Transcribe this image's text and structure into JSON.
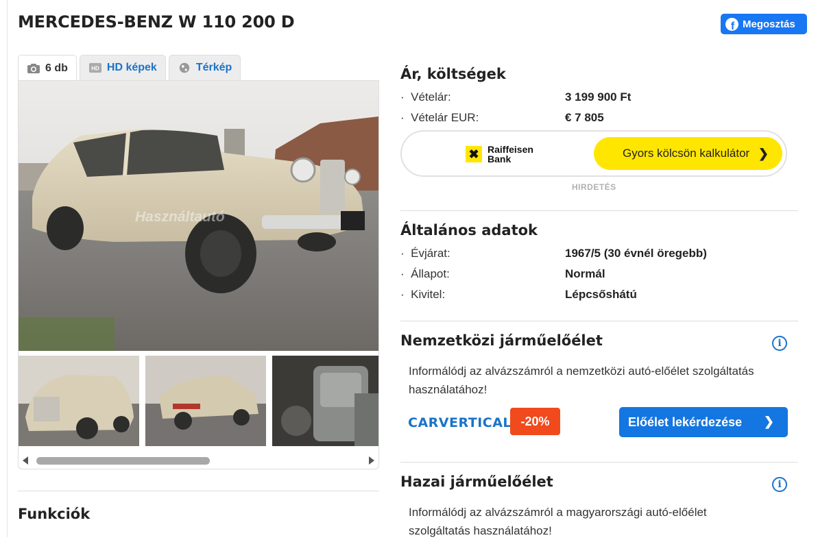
{
  "listing": {
    "title": "MERCEDES-BENZ W 110 200 D"
  },
  "share": {
    "label": "Megosztás",
    "icon": "facebook-icon"
  },
  "gallery": {
    "tabs": [
      {
        "label": "6 db",
        "icon": "camera-icon"
      },
      {
        "label": "HD képek",
        "icon": "hd-icon"
      },
      {
        "label": "Térkép",
        "icon": "globe-icon"
      }
    ],
    "watermark": "Használtautó"
  },
  "price": {
    "title": "Ár, költségek",
    "rows": [
      {
        "label": "Vételár:",
        "value": "3 199 900 Ft"
      },
      {
        "label": "Vételár EUR:",
        "value": "€ 7 805"
      }
    ]
  },
  "ad": {
    "bank_line1": "Raiffeisen",
    "bank_line2": "Bank",
    "button": "Gyors kölcsön kalkulátor",
    "tag": "HIRDETÉS"
  },
  "general": {
    "title": "Általános adatok",
    "rows": [
      {
        "label": "Évjárat:",
        "value": "1967/5 (30 évnél öregebb)"
      },
      {
        "label": "Állapot:",
        "value": "Normál"
      },
      {
        "label": "Kivitel:",
        "value": "Lépcsőshátú"
      }
    ]
  },
  "international": {
    "title": "Nemzetközi járműelőélet",
    "text": "Informálódj az alvázszámról a nemzetközi autó-előélet szolgáltatás használatához!",
    "brand": "CARVERTICAL",
    "discount": "-20%",
    "button": "Előélet lekérdezése"
  },
  "domestic": {
    "title": "Hazai járműelőélet",
    "text": "Informálódj az alvázszámról a magyarországi autó-előélet szolgáltatás használatához!"
  },
  "functions": {
    "title": "Funkciók"
  },
  "colors": {
    "accent": "#1a73c9",
    "share": "#1877f2",
    "yellow": "#ffe600",
    "discount": "#f04a1d"
  }
}
